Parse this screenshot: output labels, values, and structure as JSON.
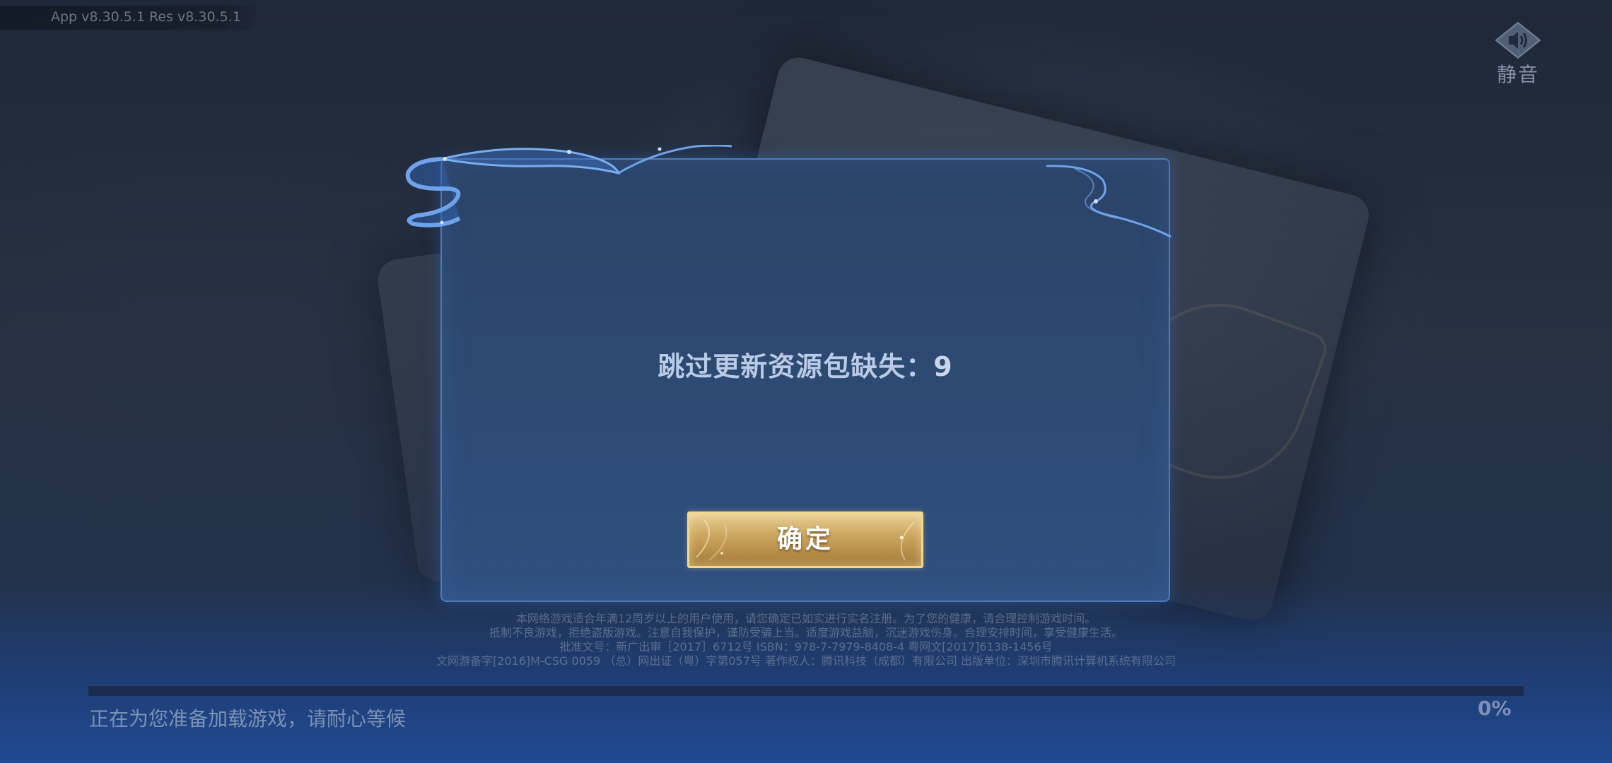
{
  "version_info": "App v8.30.5.1  Res v8.30.5.1",
  "mute": {
    "label": "静音",
    "icon": "speaker-icon"
  },
  "dialog": {
    "message": "跳过更新资源包缺失：",
    "count": "9",
    "confirm_label": "确定"
  },
  "notice": {
    "lines": [
      "本网络游戏适合年满12周岁以上的用户使用，请您确定已如实进行实名注册。为了您的健康，请合理控制游戏时间。",
      "抵制不良游戏，拒绝盗版游戏。注意自我保护，谨防受骗上当。适度游戏益脑，沉迷游戏伤身。合理安排时间，享受健康生活。",
      "批准文号：新广出审［2017］6712号  ISBN：978-7-7979-8408-4  粤网文[2017]6138-1456号",
      "文网游备字[2016]M-CSG 0059 （总）网出证（粤）字第057号  著作权人：腾讯科技（成都）有限公司  出版单位：深圳市腾讯计算机系统有限公司"
    ]
  },
  "loading": {
    "status_text": "正在为您准备加载游戏，请耐心等候",
    "percent_label": "0%",
    "progress": 0
  },
  "colors": {
    "dialog_border": "#5a8cd2",
    "button_gold": "#caa35c",
    "message_text": "#b9cbe6"
  }
}
